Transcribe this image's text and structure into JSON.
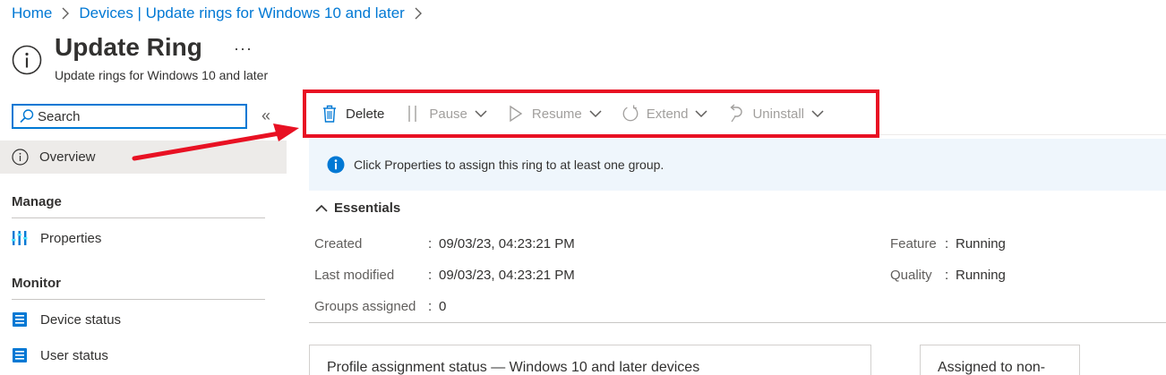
{
  "breadcrumb": {
    "items": [
      "Home",
      "Devices | Update rings for Windows 10 and later"
    ]
  },
  "header": {
    "icon": "info-circle-icon",
    "title": "Update Ring",
    "more": "···",
    "subtitle": "Update rings for Windows 10 and later"
  },
  "sidebar": {
    "search_placeholder": "Search",
    "collapse": "«",
    "overview": "Overview",
    "sections": [
      {
        "title": "Manage",
        "items": [
          {
            "label": "Properties",
            "icon": "properties-icon"
          }
        ]
      },
      {
        "title": "Monitor",
        "items": [
          {
            "label": "Device status",
            "icon": "device-status-icon"
          },
          {
            "label": "User status",
            "icon": "user-status-icon"
          }
        ]
      }
    ]
  },
  "toolbar": {
    "delete": "Delete",
    "pause": "Pause",
    "resume": "Resume",
    "extend": "Extend",
    "uninstall": "Uninstall",
    "highlight_color": "#e81123"
  },
  "info_bar": {
    "text": "Click Properties to assign this ring to at least one group."
  },
  "essentials": {
    "title": "Essentials",
    "rows": [
      {
        "label": "Created",
        "value": "09/03/23, 04:23:21 PM"
      },
      {
        "label": "Last modified",
        "value": "09/03/23, 04:23:21 PM"
      },
      {
        "label": "Groups assigned",
        "value": "0"
      }
    ],
    "right_rows": [
      {
        "label": "Feature",
        "value": "Running"
      },
      {
        "label": "Quality",
        "value": "Running"
      }
    ],
    "separator": ":"
  },
  "cards": [
    {
      "title": "Profile assignment status — Windows 10 and later devices"
    },
    {
      "title": "Assigned to non-"
    }
  ],
  "colors": {
    "accent": "#0078d4",
    "annotation": "#e81123",
    "info_bg": "#eff6fc"
  }
}
